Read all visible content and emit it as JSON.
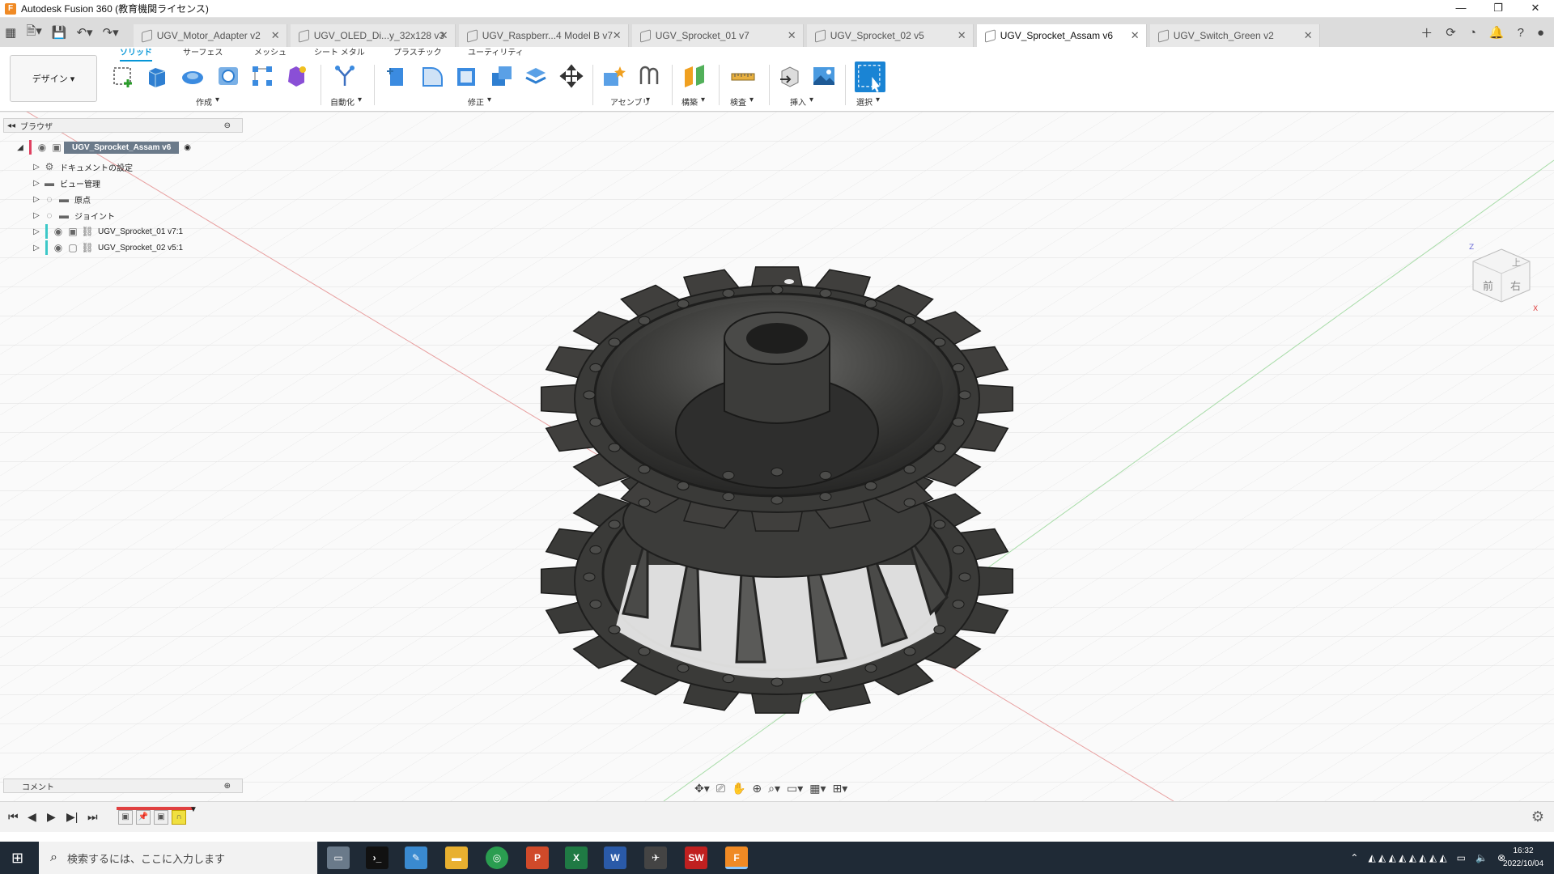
{
  "window": {
    "title": "Autodesk Fusion 360 (教育機関ライセンス)"
  },
  "tabs": [
    {
      "label": "UGV_Motor_Adapter v2",
      "active": false
    },
    {
      "label": "UGV_OLED_Di...y_32x128 v3",
      "active": false
    },
    {
      "label": "UGV_Raspberr...4 Model B v7",
      "active": false
    },
    {
      "label": "UGV_Sprocket_01 v7",
      "active": false
    },
    {
      "label": "UGV_Sprocket_02 v5",
      "active": false
    },
    {
      "label": "UGV_Sprocket_Assam v6",
      "active": true
    },
    {
      "label": "UGV_Switch_Green v2",
      "active": false
    }
  ],
  "ribbon": {
    "workspace": "デザイン",
    "tabs": [
      "ソリッド",
      "サーフェス",
      "メッシュ",
      "シート メタル",
      "プラスチック",
      "ユーティリティ"
    ],
    "groups": [
      "作成",
      "自動化",
      "修正",
      "アセンブリ",
      "構築",
      "検査",
      "挿入",
      "選択"
    ]
  },
  "browser": {
    "title": "ブラウザ",
    "root": "UGV_Sprocket_Assam v6",
    "items": [
      {
        "label": "ドキュメントの設定",
        "icon": "gear-icon"
      },
      {
        "label": "ビュー管理",
        "icon": "folder-icon"
      },
      {
        "label": "原点",
        "icon": "folder-icon"
      },
      {
        "label": "ジョイント",
        "icon": "folder-icon"
      },
      {
        "label": "UGV_Sprocket_01 v7:1",
        "icon": "component-icon"
      },
      {
        "label": "UGV_Sprocket_02 v5:1",
        "icon": "component-icon"
      }
    ]
  },
  "comment": {
    "title": "コメント"
  },
  "viewcube": {
    "top": "上",
    "front": "前",
    "right": "右",
    "axis_z": "Z",
    "axis_x": "X"
  },
  "taskbar": {
    "search_placeholder": "検索するには、ここに入力します",
    "time": "16:32",
    "date": "2022/10/04"
  },
  "colors": {
    "accent": "#0696d7",
    "model": "#3d3d3b",
    "taskbar": "#1f2a36"
  }
}
